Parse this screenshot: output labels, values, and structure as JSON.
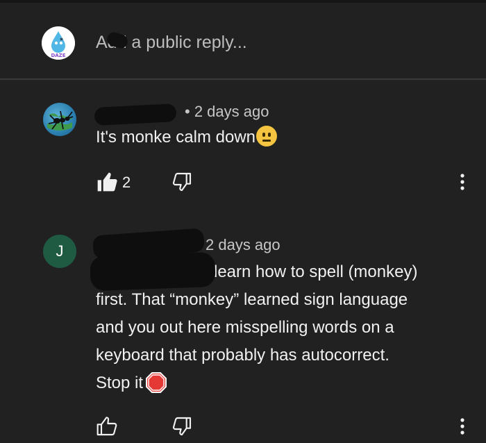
{
  "composer": {
    "placeholder": "Add a public reply...",
    "avatar_icon": "water-drop-avatar"
  },
  "comments": [
    {
      "author": "",
      "time": "2 days ago",
      "text": "It's monke calm down",
      "emoji": "neutral-face",
      "likes": "2",
      "avatar_icon": "ant-globe-avatar"
    },
    {
      "author": "",
      "avatar_letter": "J",
      "time": "2 days ago",
      "text_lines": [
        "learn how to spell (monkey)",
        "first. That “monkey” learned sign language",
        "and you out here misspelling words on a",
        "keyboard that probably has autocorrect.",
        "Stop it"
      ],
      "emoji": "stop-sign",
      "likes": ""
    }
  ],
  "colors": {
    "background": "#212121",
    "text": "#f1f1f1",
    "meta": "#c7c7c7",
    "avatar_j": "#1f5a43",
    "stop": "#e53935"
  }
}
